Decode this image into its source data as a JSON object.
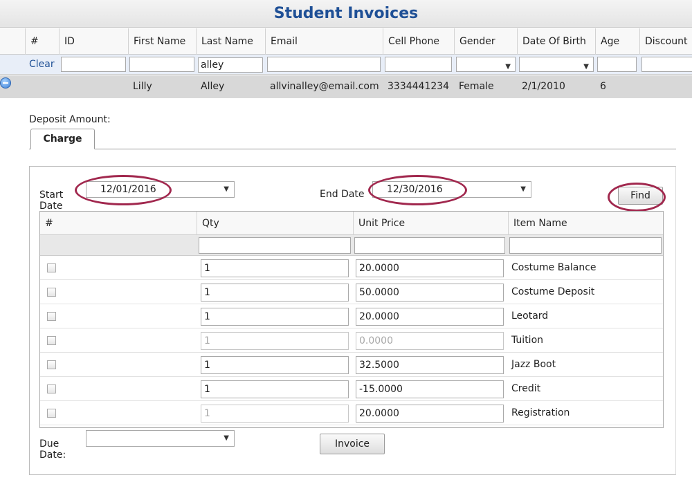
{
  "title": "Student Invoices",
  "students_grid": {
    "columns": [
      "#",
      "ID",
      "First Name",
      "Last Name",
      "Email",
      "Cell Phone",
      "Gender",
      "Date Of Birth",
      "Age",
      "Discount"
    ],
    "filter": {
      "clear_label": "Clear",
      "last_name_value": "alley"
    },
    "row": {
      "first_name": "Lilly",
      "last_name": "Alley",
      "email": "allvinalley@email.com",
      "cell_phone": "3334441234",
      "gender": "Female",
      "date_of_birth": "2/1/2010",
      "age": "6"
    }
  },
  "deposit_label": "Deposit Amount:",
  "tab_charge": "Charge",
  "charge_panel": {
    "start_date_label_1": "Start",
    "start_date_label_2": "Date",
    "start_date_value": "12/01/2016",
    "end_date_label": "End Date",
    "end_date_value": "12/30/2016",
    "find_label": "Find",
    "columns": [
      "#",
      "Qty",
      "Unit Price",
      "Item Name"
    ],
    "items": [
      {
        "qty": "1",
        "unit_price": "20.0000",
        "item_name": "Costume Balance",
        "disabled_qty": false,
        "disabled_price": false
      },
      {
        "qty": "1",
        "unit_price": "50.0000",
        "item_name": "Costume Deposit",
        "disabled_qty": false,
        "disabled_price": false
      },
      {
        "qty": "1",
        "unit_price": "20.0000",
        "item_name": "Leotard",
        "disabled_qty": false,
        "disabled_price": false
      },
      {
        "qty": "1",
        "unit_price": "0.0000",
        "item_name": "Tuition",
        "disabled_qty": true,
        "disabled_price": true
      },
      {
        "qty": "1",
        "unit_price": "32.5000",
        "item_name": "Jazz Boot",
        "disabled_qty": false,
        "disabled_price": false
      },
      {
        "qty": "1",
        "unit_price": "-15.0000",
        "item_name": "Credit",
        "disabled_qty": false,
        "disabled_price": false
      },
      {
        "qty": "1",
        "unit_price": "20.0000",
        "item_name": "Registration",
        "disabled_qty": true,
        "disabled_price": false
      }
    ],
    "due_date_label_1": "Due",
    "due_date_label_2": "Date:",
    "invoice_label": "Invoice"
  },
  "colors": {
    "title": "#1f5096",
    "highlight_oval": "#a1284e"
  }
}
